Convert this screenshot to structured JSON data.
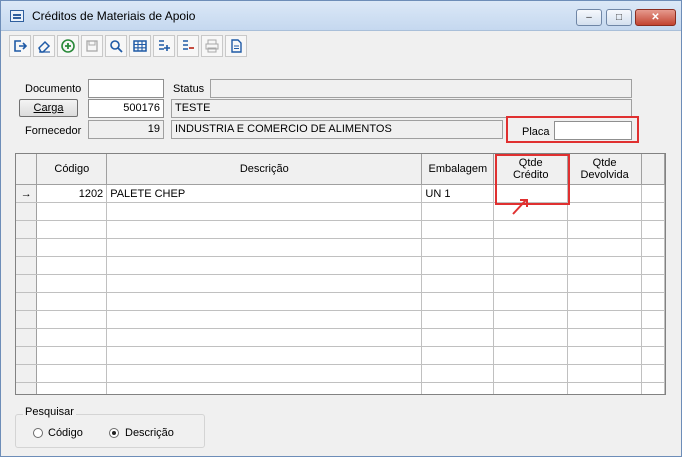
{
  "window": {
    "title": "Créditos de Materiais de Apoio"
  },
  "toolbar": {
    "buttons": [
      {
        "icon": "exit-icon"
      },
      {
        "icon": "eraser-icon"
      },
      {
        "icon": "add-icon"
      },
      {
        "icon": "save-icon"
      },
      {
        "icon": "search-icon"
      },
      {
        "icon": "table-icon"
      },
      {
        "icon": "add-row-icon"
      },
      {
        "icon": "remove-row-icon"
      },
      {
        "icon": "print-icon"
      },
      {
        "icon": "document-icon"
      }
    ]
  },
  "form": {
    "documento_label": "Documento",
    "documento_value": "",
    "status_label": "Status",
    "status_value": "",
    "carga_button": "Carga",
    "carga_code": "500176",
    "carga_desc": "TESTE",
    "fornecedor_label": "Fornecedor",
    "fornecedor_code": "19",
    "fornecedor_name": "INDUSTRIA E COMERCIO DE ALIMENTOS",
    "placa_label": "Placa",
    "placa_value": ""
  },
  "grid": {
    "columns": [
      "Código",
      "Descrição",
      "Embalagem",
      "Qtde Crédito",
      "Qtde Devolvida"
    ],
    "rows": [
      {
        "indicator": "→",
        "codigo": "1202",
        "descricao": "PALETE CHEP",
        "embalagem": "UN 1",
        "qtde_credito": "",
        "qtde_devolvida": ""
      }
    ]
  },
  "search": {
    "group_label": "Pesquisar",
    "options": [
      "Código",
      "Descrição"
    ],
    "selected": "Descrição"
  },
  "colors": {
    "highlight": "#e03030",
    "accent": "#2f5f9e"
  }
}
